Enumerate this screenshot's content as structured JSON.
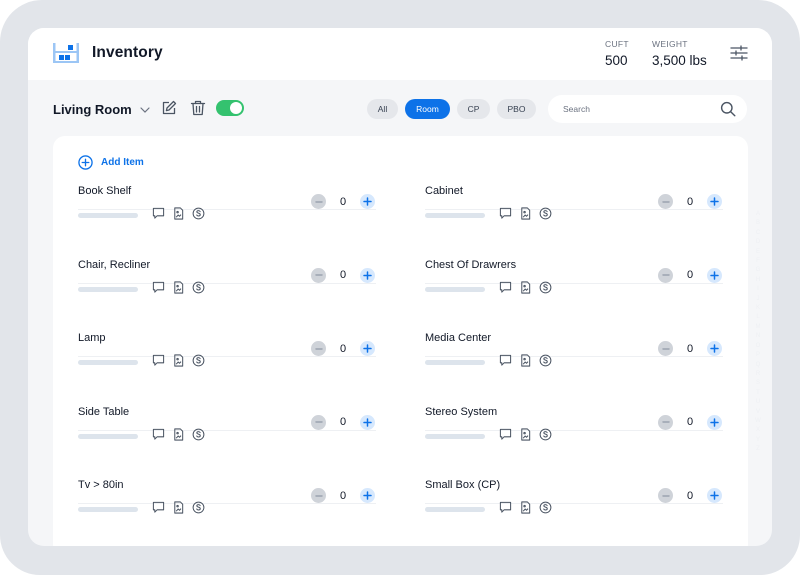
{
  "header": {
    "title": "Inventory",
    "logo_icon": "warehouse-shelf-icon",
    "cuft_label": "CUFT",
    "cuft_value": "500",
    "weight_label": "WEIGHT",
    "weight_value": "3,500 lbs",
    "filter_icon": "sliders-icon"
  },
  "toolbar": {
    "room": "Living Room",
    "room_toggle_on": true,
    "filters": [
      {
        "label": "All",
        "active": false
      },
      {
        "label": "Room",
        "active": true
      },
      {
        "label": "CP",
        "active": false
      },
      {
        "label": "PBO",
        "active": false
      }
    ],
    "search_placeholder": "Search",
    "search_value": ""
  },
  "content": {
    "add_item_label": "Add Item",
    "items": [
      {
        "name": "Book Shelf",
        "qty": "0"
      },
      {
        "name": "Cabinet",
        "qty": "0"
      },
      {
        "name": "Chair, Recliner",
        "qty": "0"
      },
      {
        "name": "Chest Of Drawrers",
        "qty": "0"
      },
      {
        "name": "Lamp",
        "qty": "0"
      },
      {
        "name": "Media Center",
        "qty": "0"
      },
      {
        "name": "Side Table",
        "qty": "0"
      },
      {
        "name": "Stereo System",
        "qty": "0"
      },
      {
        "name": "Tv > 80in",
        "qty": "0"
      },
      {
        "name": "Small Box (CP)",
        "qty": "0"
      }
    ]
  },
  "alpha_index": [
    "A",
    "B",
    "C",
    "D",
    "E",
    "F",
    "G",
    "H",
    "I",
    "J",
    "K",
    "L",
    "M",
    "N",
    "O",
    "P",
    "Q",
    "R",
    "S",
    "T",
    "U",
    "V",
    "W",
    "X",
    "Y",
    "Z"
  ],
  "colors": {
    "accent": "#0d72e8",
    "toggle_on": "#34c26f",
    "device_frame": "#e2e5ea",
    "background": "#f5f6f8"
  }
}
